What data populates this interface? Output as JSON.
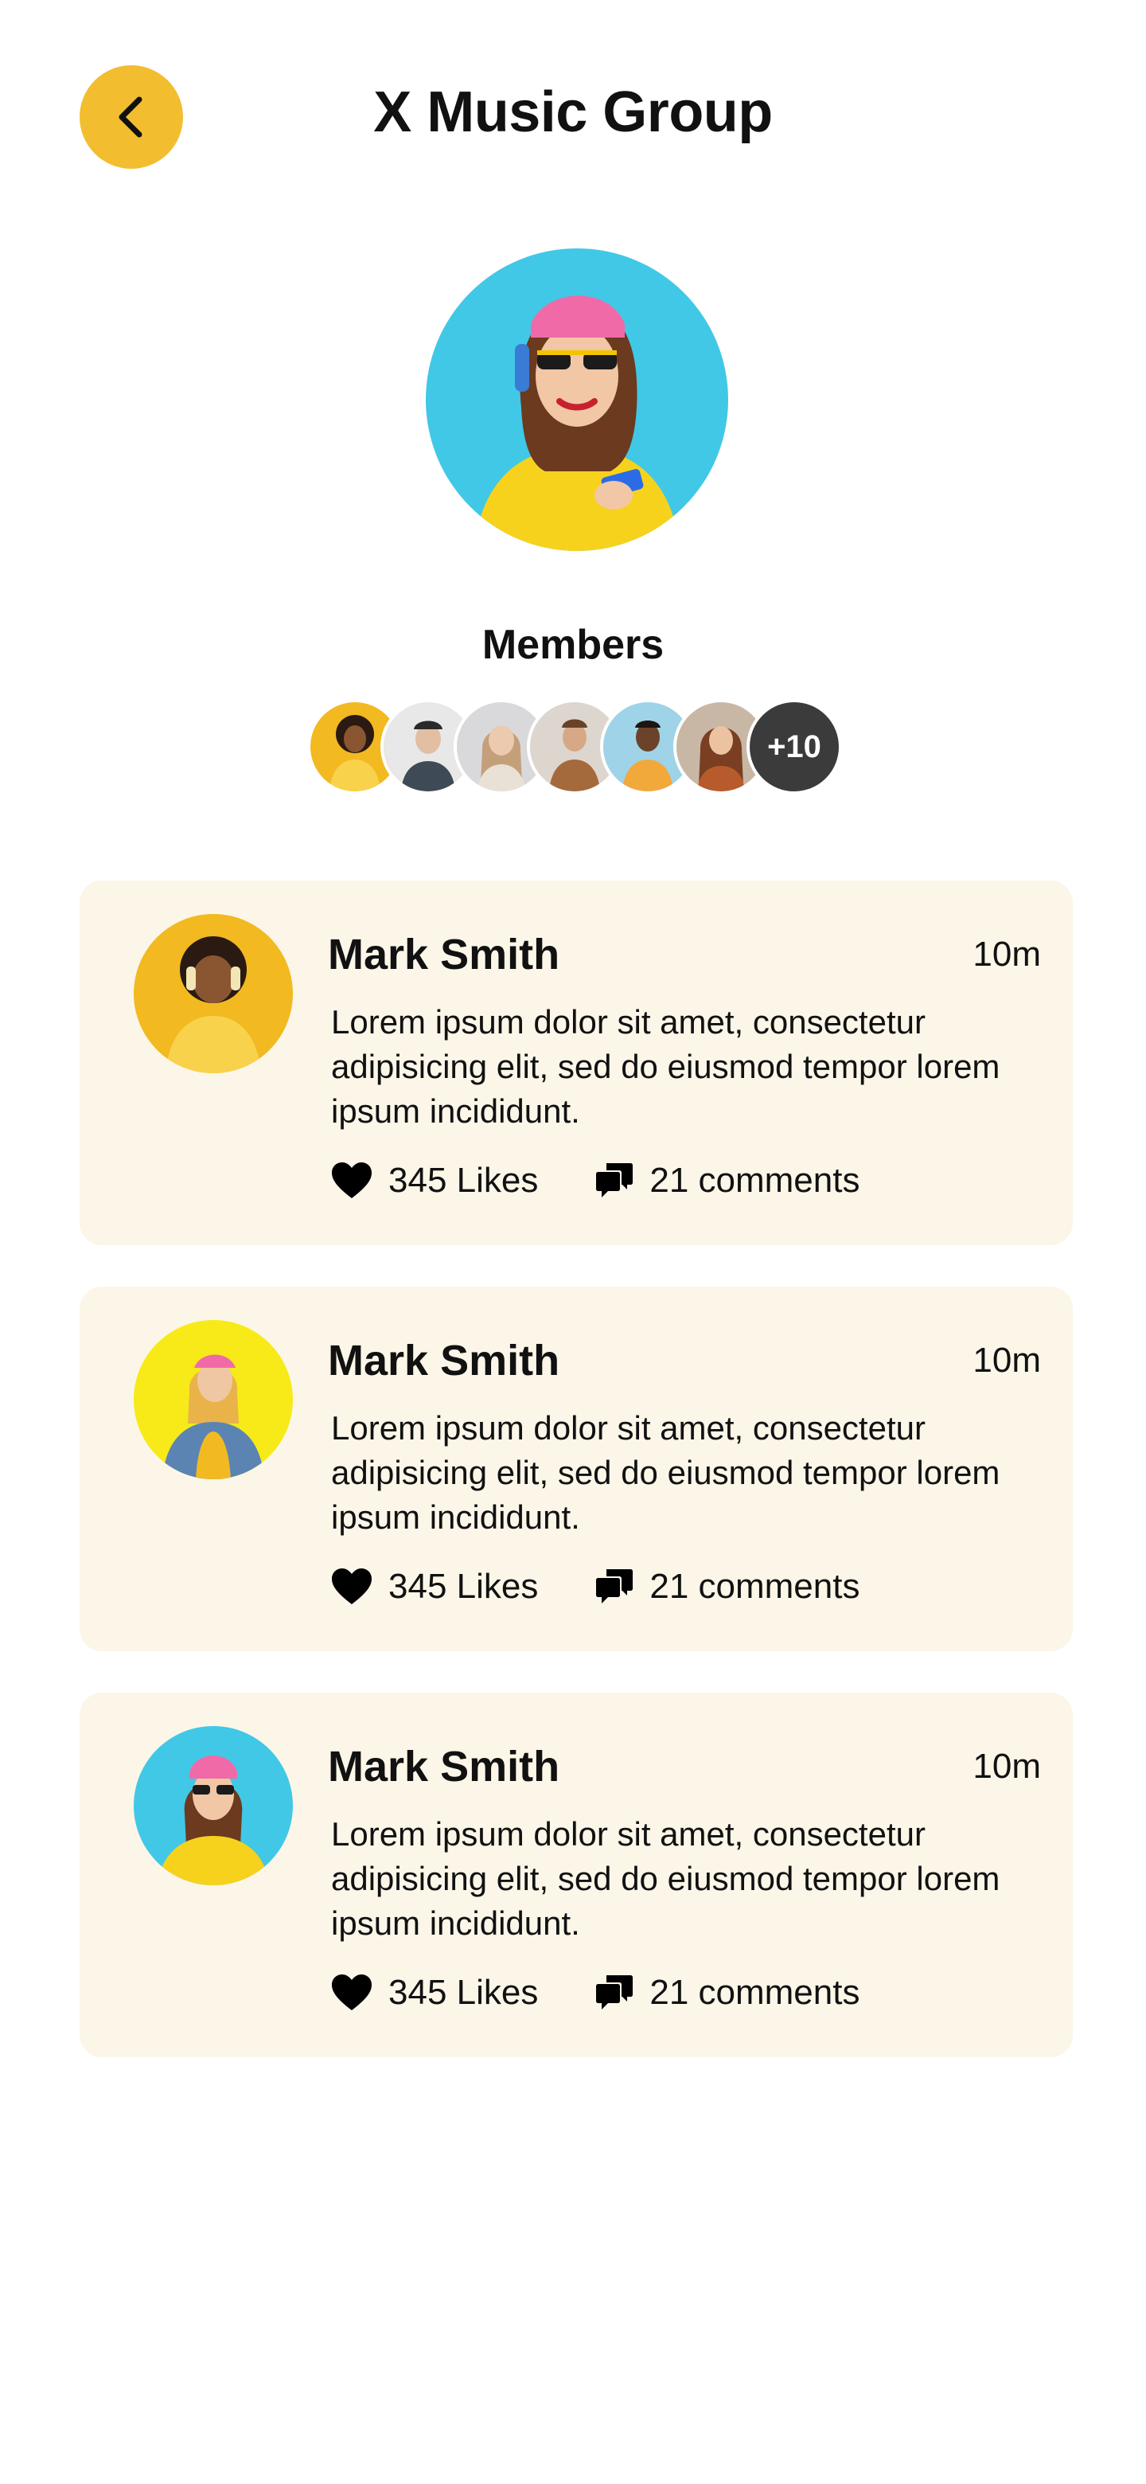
{
  "header": {
    "title": "X Music Group",
    "back_icon": "chevron-left-icon",
    "accent_color": "#f2bd2f"
  },
  "members": {
    "label": "Members",
    "more_count": "+10"
  },
  "posts": [
    {
      "name": "Mark Smith",
      "time": "10m",
      "text": "Lorem ipsum dolor sit amet, consectetur adipisicing elit, sed do eiusmod tempor lorem ipsum incididunt.",
      "likes": "345 Likes",
      "comments": "21 comments"
    },
    {
      "name": "Mark Smith",
      "time": "10m",
      "text": "Lorem ipsum dolor sit amet, consectetur adipisicing elit, sed do eiusmod tempor lorem ipsum incididunt.",
      "likes": "345 Likes",
      "comments": "21 comments"
    },
    {
      "name": "Mark Smith",
      "time": "10m",
      "text": "Lorem ipsum dolor sit amet, consectetur adipisicing elit, sed do eiusmod tempor lorem ipsum incididunt.",
      "likes": "345 Likes",
      "comments": "21 comments"
    }
  ],
  "colors": {
    "card_background": "#fcf6e9",
    "text": "#111111"
  }
}
